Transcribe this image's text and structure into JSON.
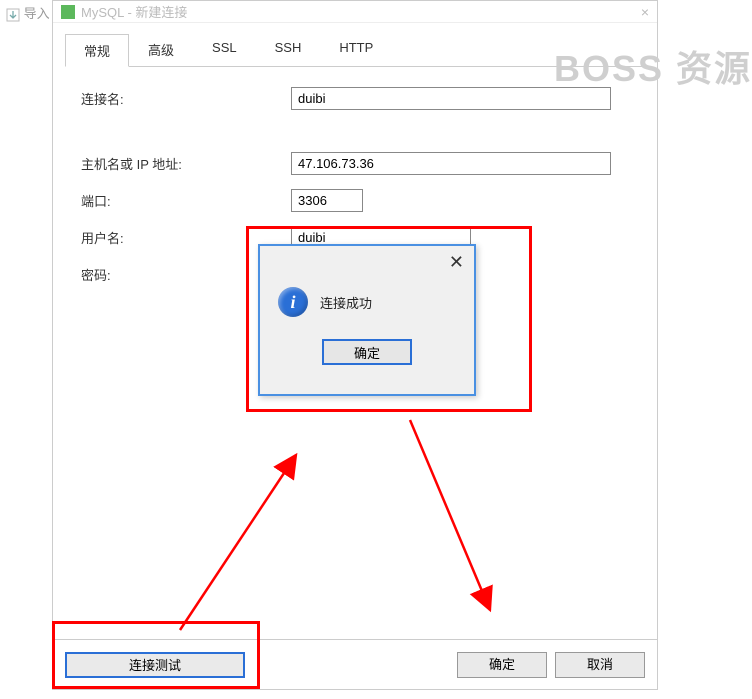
{
  "background": {
    "import_label": "导入"
  },
  "window": {
    "title": "MySQL - 新建连接",
    "tabs": [
      "常规",
      "高级",
      "SSL",
      "SSH",
      "HTTP"
    ],
    "active_tab_index": 0,
    "fields": {
      "conn_name_label": "连接名:",
      "conn_name_value": "duibi",
      "host_label": "主机名或 IP 地址:",
      "host_value": "47.106.73.36",
      "port_label": "端口:",
      "port_value": "3306",
      "user_label": "用户名:",
      "user_value": "duibi",
      "password_label": "密码:",
      "password_value": "••••••••••••"
    },
    "buttons": {
      "test": "连接测试",
      "ok": "确定",
      "cancel": "取消"
    }
  },
  "msgbox": {
    "text": "连接成功",
    "ok": "确定"
  },
  "watermark": "BOSS 资源"
}
